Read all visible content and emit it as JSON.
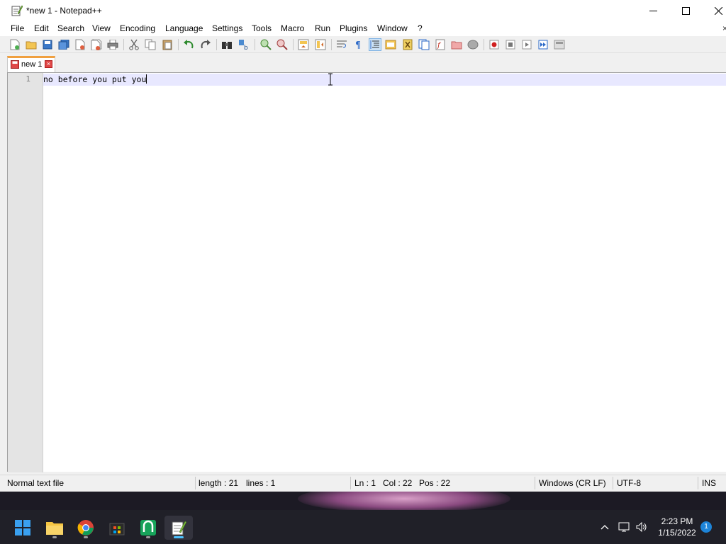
{
  "window": {
    "title": "*new 1 - Notepad++"
  },
  "menu": {
    "items": [
      "File",
      "Edit",
      "Search",
      "View",
      "Encoding",
      "Language",
      "Settings",
      "Tools",
      "Macro",
      "Run",
      "Plugins",
      "Window",
      "?"
    ],
    "close_glyph": "×"
  },
  "toolbar": {
    "icons": [
      "new-file-icon",
      "open-file-icon",
      "save-icon",
      "save-all-icon",
      "close-icon",
      "close-all-icon",
      "print-icon",
      "cut-icon",
      "copy-icon",
      "paste-icon",
      "undo-icon",
      "redo-icon",
      "find-icon",
      "replace-icon",
      "zoom-in-icon",
      "zoom-out-icon",
      "sync-vertical-icon",
      "sync-horizontal-icon",
      "word-wrap-icon",
      "show-all-characters-icon",
      "indent-guide-icon",
      "user-defined-language-icon",
      "document-map-icon",
      "document-list-icon",
      "function-list-icon",
      "folder-as-workspace-icon",
      "monitoring-icon",
      "record-macro-icon",
      "stop-recording-icon",
      "playback-macro-icon",
      "run-macro-multiple-icon",
      "save-macro-icon"
    ],
    "pressed": "indent-guide-icon"
  },
  "tabs": [
    {
      "label": "new 1",
      "close_glyph": "×",
      "modified": true
    }
  ],
  "editor": {
    "line_number": "1",
    "text": "no before you put you"
  },
  "status": {
    "file_type": "Normal text file",
    "length": "length : 21",
    "lines": "lines : 1",
    "ln": "Ln : 1",
    "col": "Col : 22",
    "pos": "Pos : 22",
    "eol": "Windows (CR LF)",
    "encoding": "UTF-8",
    "mode": "INS"
  },
  "taskbar": {
    "apps": [
      "windows-start-icon",
      "file-explorer-icon",
      "chrome-icon",
      "microsoft-store-icon",
      "green-app-icon",
      "notepadpp-icon"
    ],
    "active_app": "notepadpp-icon",
    "time": "2:23 PM",
    "date": "1/15/2022",
    "notifications": "1"
  },
  "colors": {
    "tab_accent": "#f0a040",
    "current_line": "#e8e8ff",
    "taskbar_active": "#4cc2ff",
    "notification_badge": "#1d84d8"
  }
}
